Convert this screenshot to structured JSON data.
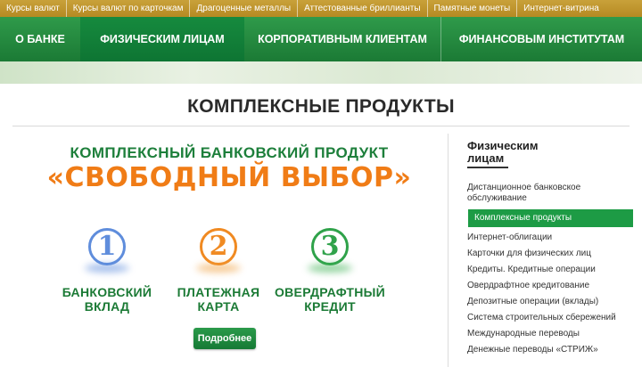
{
  "topbar": {
    "items": [
      {
        "label": "Курсы валют"
      },
      {
        "label": "Курсы валют по карточкам"
      },
      {
        "label": "Драгоценные металлы"
      },
      {
        "label": "Аттестованные бриллианты"
      },
      {
        "label": "Памятные монеты"
      },
      {
        "label": "Интернет-витрина"
      }
    ]
  },
  "nav": {
    "items": [
      {
        "label": "О банке"
      },
      {
        "label": "Физическим лицам"
      },
      {
        "label": "Корпоративным клиентам"
      },
      {
        "label": "Финансовым институтам"
      }
    ]
  },
  "page": {
    "title": "КОМПЛЕКСНЫЕ ПРОДУКТЫ"
  },
  "promo": {
    "subtitle": "КОМПЛЕКСНЫЙ БАНКОВСКИЙ ПРОДУКТ",
    "title": "«СВОБОДНЫЙ ВЫБОР»",
    "steps": [
      {
        "number": "1",
        "line1": "Банковский",
        "line2": "вклад",
        "color": "#5f8ddc"
      },
      {
        "number": "2",
        "line1": "Платежная",
        "line2": "карта",
        "color": "#f08a22"
      },
      {
        "number": "3",
        "line1": "Овердрафтный",
        "line2": "кредит",
        "color": "#2fa24a"
      }
    ],
    "more_label": "Подробнее"
  },
  "sidebar": {
    "heading": "Физическим лицам",
    "items": [
      {
        "label": "Дистанционное банковское обслуживание"
      },
      {
        "label": "Комплексные продукты"
      },
      {
        "label": "Интернет-облигации"
      },
      {
        "label": "Карточки для физических лиц"
      },
      {
        "label": "Кредиты. Кредитные операции"
      },
      {
        "label": "Овердрафтное кредитование"
      },
      {
        "label": "Депозитные операции (вклады)"
      },
      {
        "label": "Система строительных сбережений"
      },
      {
        "label": "Международные переводы"
      },
      {
        "label": "Денежные переводы «СТРИЖ»"
      }
    ]
  },
  "colors": {
    "brand_green": "#1b7a35",
    "accent_orange": "#f07c16",
    "topbar_gold": "#b58a22"
  }
}
